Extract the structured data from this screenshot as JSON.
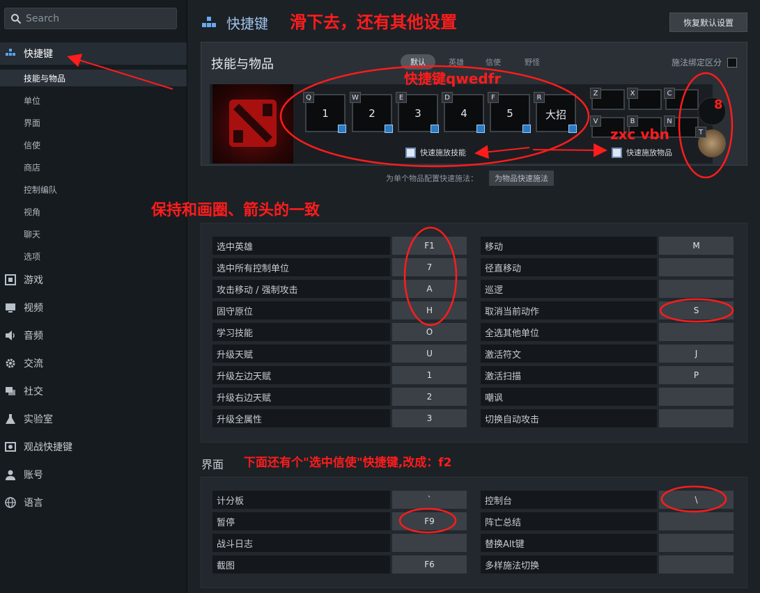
{
  "search": {
    "placeholder": "Search"
  },
  "sidebar": {
    "active": {
      "label": "快捷键"
    },
    "sub_items": [
      "技能与物品",
      "单位",
      "界面",
      "信使",
      "商店",
      "控制编队",
      "视角",
      "聊天",
      "选项"
    ],
    "items": [
      {
        "label": "游戏",
        "icon": "controller-icon"
      },
      {
        "label": "视频",
        "icon": "monitor-icon"
      },
      {
        "label": "音频",
        "icon": "speaker-icon"
      },
      {
        "label": "交流",
        "icon": "gear-icon"
      },
      {
        "label": "社交",
        "icon": "chat-icon"
      },
      {
        "label": "实验室",
        "icon": "flask-icon"
      },
      {
        "label": "观战快捷键",
        "icon": "spectate-icon"
      },
      {
        "label": "账号",
        "icon": "user-icon"
      },
      {
        "label": "语言",
        "icon": "globe-icon"
      }
    ]
  },
  "header": {
    "title": "快捷键",
    "reset_label": "恢复默认设置"
  },
  "abilities": {
    "title": "技能与物品",
    "tabs": [
      "默认",
      "英雄",
      "信使",
      "野怪"
    ],
    "cast_bind_label": "施法绑定区分",
    "ability_slots": [
      {
        "key": "Q",
        "value": "1"
      },
      {
        "key": "W",
        "value": "2"
      },
      {
        "key": "E",
        "value": "3"
      },
      {
        "key": "D",
        "value": "4"
      },
      {
        "key": "F",
        "value": "5"
      },
      {
        "key": "R",
        "value": "大招"
      }
    ],
    "item_keys": [
      "Z",
      "X",
      "C",
      "V",
      "B",
      "N"
    ],
    "extra_slots": {
      "circle_value": "8",
      "tp_key": "T"
    },
    "quick_cast_ability": "快速施放技能",
    "quick_cast_item": "快速施放物品",
    "per_item_label": "为单个物品配置快速施法：",
    "per_item_button": "为物品快速施法"
  },
  "units_table": {
    "left": [
      {
        "label": "选中英雄",
        "key": "F1"
      },
      {
        "label": "选中所有控制单位",
        "key": "7"
      },
      {
        "label": "攻击移动 / 强制攻击",
        "key": "A"
      },
      {
        "label": "固守原位",
        "key": "H"
      },
      {
        "label": "学习技能",
        "key": "O"
      },
      {
        "label": "升级天赋",
        "key": "U"
      },
      {
        "label": "升级左边天赋",
        "key": "1"
      },
      {
        "label": "升级右边天赋",
        "key": "2"
      },
      {
        "label": "升级全属性",
        "key": "3"
      }
    ],
    "right": [
      {
        "label": "移动",
        "key": "M"
      },
      {
        "label": "径直移动",
        "key": ""
      },
      {
        "label": "巡逻",
        "key": ""
      },
      {
        "label": "取消当前动作",
        "key": "S"
      },
      {
        "label": "全选其他单位",
        "key": ""
      },
      {
        "label": "激活符文",
        "key": "J"
      },
      {
        "label": "激活扫描",
        "key": "P"
      },
      {
        "label": "嘲讽",
        "key": ""
      },
      {
        "label": "切换自动攻击",
        "key": ""
      }
    ]
  },
  "ui_section": {
    "heading": "界面",
    "left": [
      {
        "label": "计分板",
        "key": "`"
      },
      {
        "label": "暂停",
        "key": "F9"
      },
      {
        "label": "战斗日志",
        "key": ""
      },
      {
        "label": "截图",
        "key": "F6"
      }
    ],
    "right": [
      {
        "label": "控制台",
        "key": "\\"
      },
      {
        "label": "阵亡总结",
        "key": ""
      },
      {
        "label": "替换Alt键",
        "key": ""
      },
      {
        "label": "多样施法切换",
        "key": ""
      }
    ]
  },
  "annotations": {
    "scroll_note": "滑下去，还有其他设置",
    "hotkey_note": "快捷键qwedfr",
    "item_note": "zxc vbn",
    "consistency_note": "保持和画圈、箭头的一致",
    "courier_note": "下面还有个\"选中信使\"快捷键,改成：f2"
  },
  "colors": {
    "annotation": "#ff1c1c",
    "accent": "#9fc3ea"
  }
}
